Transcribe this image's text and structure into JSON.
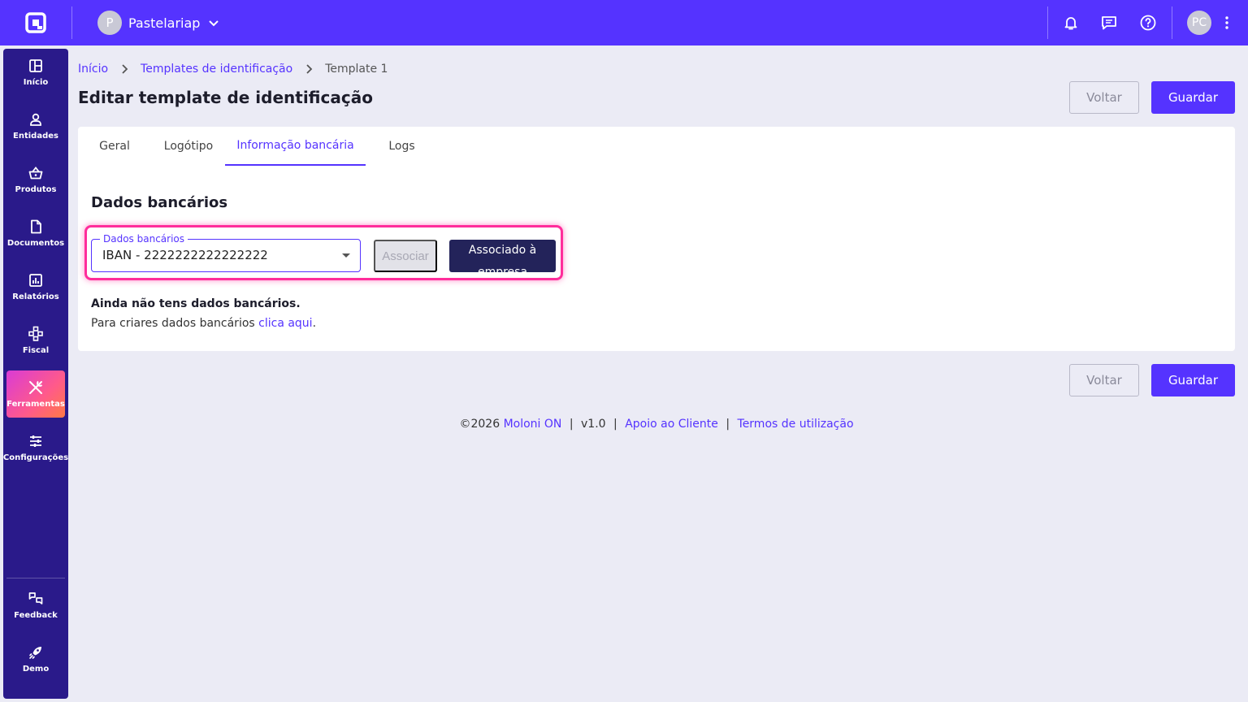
{
  "topbar": {
    "company_initial": "P",
    "company_name": "Pastelariap",
    "user_initials": "PC"
  },
  "sidebar": {
    "items": [
      {
        "label": "Início",
        "icon": "dashboard-icon"
      },
      {
        "label": "Entidades",
        "icon": "user-icon"
      },
      {
        "label": "Produtos",
        "icon": "basket-icon"
      },
      {
        "label": "Documentos",
        "icon": "document-icon"
      },
      {
        "label": "Relatórios",
        "icon": "report-icon"
      },
      {
        "label": "Fiscal",
        "icon": "fiscal-icon"
      },
      {
        "label": "Ferramentas",
        "icon": "tools-icon",
        "active": true
      },
      {
        "label": "Configurações",
        "icon": "settings-icon"
      }
    ],
    "bottom_items": [
      {
        "label": "Feedback",
        "icon": "feedback-icon"
      },
      {
        "label": "Demo",
        "icon": "rocket-icon"
      }
    ]
  },
  "breadcrumb": {
    "home": "Início",
    "section": "Templates de identificação",
    "current": "Template 1"
  },
  "page": {
    "title": "Editar template de identificação",
    "back_label": "Voltar",
    "save_label": "Guardar"
  },
  "tabs": [
    {
      "label": "Geral"
    },
    {
      "label": "Logótipo"
    },
    {
      "label": "Informação bancária",
      "active": true
    },
    {
      "label": "Logs"
    }
  ],
  "bank": {
    "section_title": "Dados bancários",
    "field_label": "Dados bancários",
    "field_value": "IBAN - 2222222222222222",
    "associate_label": "Associar",
    "associated_line1": "Associado à",
    "associated_line2": "empresa",
    "empty_title": "Ainda não tens dados bancários.",
    "empty_text": "Para criares dados bancários ",
    "empty_link": "clica aqui",
    "empty_end": "."
  },
  "footer": {
    "copyright": "©2026 ",
    "brand": "Moloni ON",
    "version": "v1.0",
    "support": "Apoio ao Cliente",
    "terms": "Termos de utilização",
    "separator": "|"
  },
  "colors": {
    "brand": "#5533ff",
    "sidebar": "#2a1a8a",
    "highlight": "#ff2d9b",
    "dark_button": "#23235a"
  }
}
